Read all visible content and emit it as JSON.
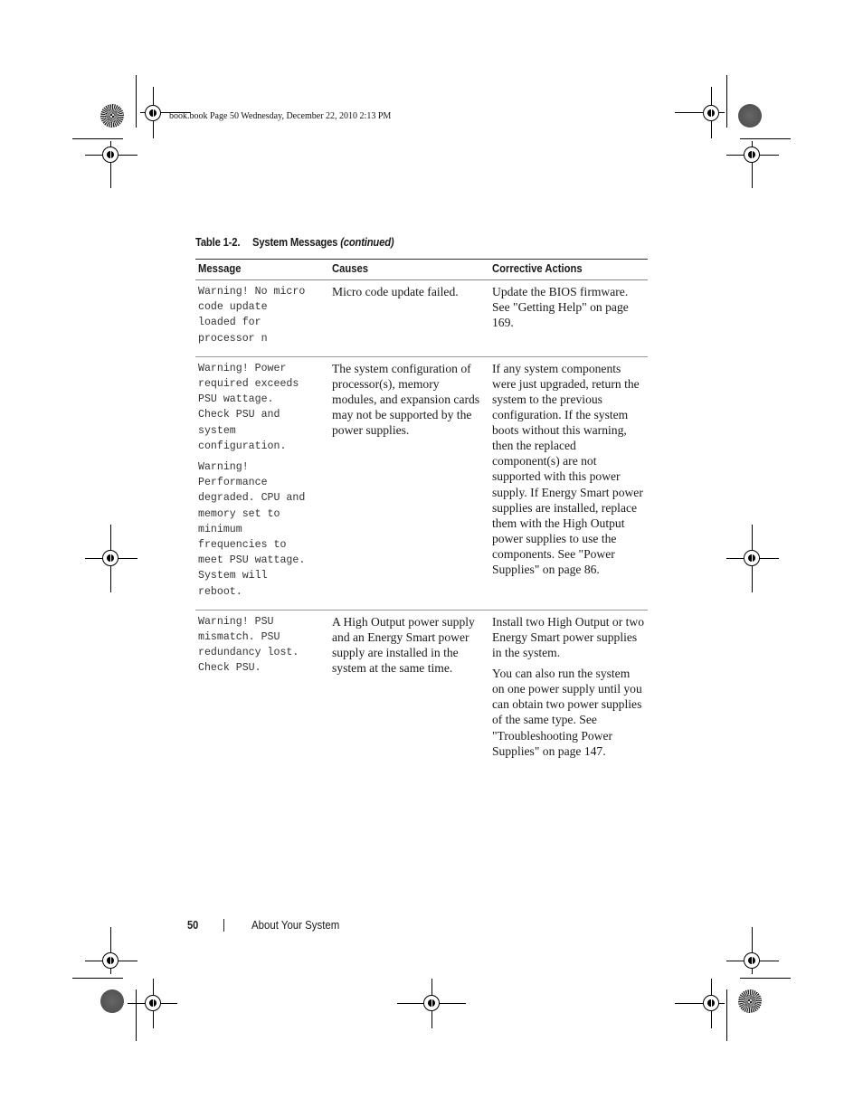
{
  "slug_line": "book.book  Page 50  Wednesday, December 22, 2010  2:13 PM",
  "caption": {
    "number": "Table 1-2.",
    "title": "System Messages",
    "continued": "(continued)"
  },
  "table": {
    "headers": [
      "Message",
      "Causes",
      "Corrective Actions"
    ],
    "rows": [
      {
        "message": [
          "Warning! No micro\ncode update\nloaded for\nprocessor n"
        ],
        "causes": [
          "Micro code update failed."
        ],
        "actions": [
          "Update the BIOS firmware. See \"Getting Help\" on page 169."
        ]
      },
      {
        "message": [
          "Warning! Power\nrequired exceeds\nPSU wattage.\nCheck PSU and\nsystem\nconfiguration.",
          "Warning!\nPerformance\ndegraded. CPU and\nmemory set to\nminimum\nfrequencies to\nmeet PSU wattage.\nSystem will\nreboot."
        ],
        "causes": [
          "The system configuration of processor(s), memory modules, and expansion cards may not be supported by the power supplies."
        ],
        "actions": [
          "If any system components were just upgraded, return the system to the previous configuration. If the system boots without this warning, then the replaced component(s) are not supported with this power supply. If Energy Smart power supplies are installed, replace them with the High Output power supplies to use the components. See \"Power Supplies\" on page 86."
        ]
      },
      {
        "message": [
          "Warning! PSU\nmismatch. PSU\nredundancy lost.\nCheck PSU."
        ],
        "causes": [
          "A High Output power supply and an Energy Smart power supply are installed in the system at the same time."
        ],
        "actions": [
          "Install two High Output or two Energy Smart power supplies in the system.",
          "You can also run the system on one power supply until you can obtain two power supplies of the same type. See \"Troubleshooting Power Supplies\" on page 147."
        ]
      }
    ]
  },
  "footer": {
    "page_number": "50",
    "section_title": "About Your System"
  }
}
